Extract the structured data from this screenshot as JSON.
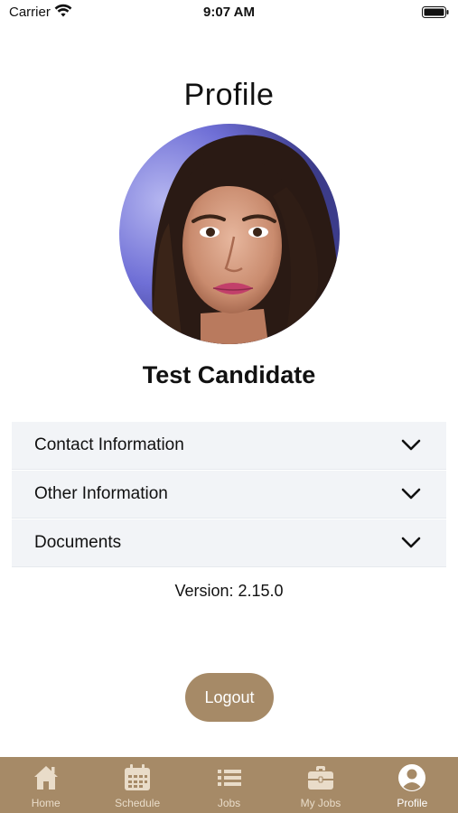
{
  "status_bar": {
    "carrier": "Carrier",
    "time": "9:07 AM"
  },
  "page": {
    "title": "Profile",
    "user_name": "Test Candidate",
    "version_text": "Version: 2.15.0"
  },
  "accordion": {
    "items": [
      {
        "label": "Contact Information",
        "icon": "chevron-down-icon"
      },
      {
        "label": "Other Information",
        "icon": "chevron-down-icon"
      },
      {
        "label": "Documents",
        "icon": "chevron-down-icon"
      }
    ]
  },
  "actions": {
    "logout_label": "Logout"
  },
  "tab_bar": {
    "items": [
      {
        "label": "Home",
        "icon": "home-icon",
        "active": false
      },
      {
        "label": "Schedule",
        "icon": "calendar-icon",
        "active": false
      },
      {
        "label": "Jobs",
        "icon": "list-icon",
        "active": false
      },
      {
        "label": "My Jobs",
        "icon": "briefcase-icon",
        "active": false
      },
      {
        "label": "Profile",
        "icon": "user-circle-icon",
        "active": true
      }
    ]
  },
  "colors": {
    "brand": "#a68a67",
    "accordion_bg": "#f2f4f7",
    "tab_inactive": "#e9dcc9",
    "tab_active": "#ffffff"
  }
}
